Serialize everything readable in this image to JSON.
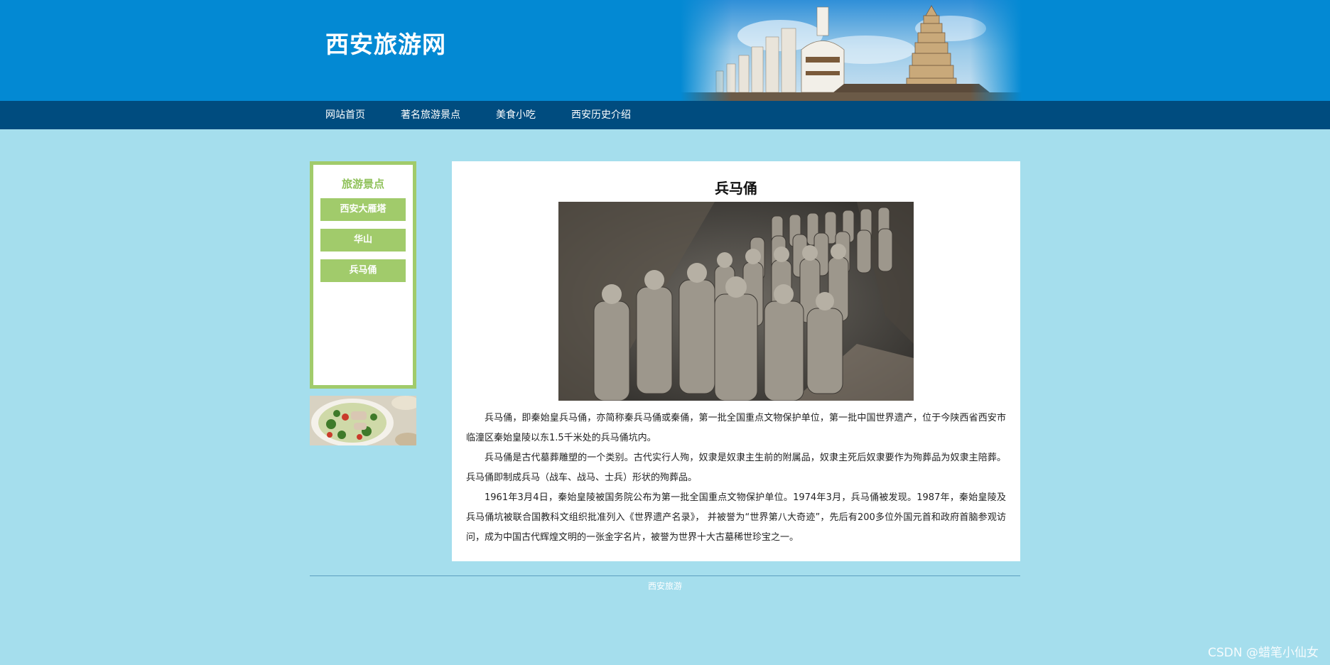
{
  "site": {
    "logo": "西安旅游网"
  },
  "nav": {
    "items": [
      {
        "label": "网站首页"
      },
      {
        "label": "著名旅游景点"
      },
      {
        "label": "美食小吃"
      },
      {
        "label": "西安历史介绍"
      }
    ]
  },
  "sidebar": {
    "title": "旅游景点",
    "items": [
      {
        "label": "西安大雁塔"
      },
      {
        "label": "华山"
      },
      {
        "label": "兵马俑"
      }
    ]
  },
  "article": {
    "title": "兵马俑",
    "paragraphs": [
      "兵马俑，即秦始皇兵马俑，亦简称秦兵马俑或秦俑，第一批全国重点文物保护单位，第一批中国世界遗产，位于今陕西省西安市临潼区秦始皇陵以东1.5千米处的兵马俑坑内。",
      "兵马俑是古代墓葬雕塑的一个类别。古代实行人殉，奴隶是奴隶主生前的附属品，奴隶主死后奴隶要作为殉葬品为奴隶主陪葬。兵马俑即制成兵马（战车、战马、士兵）形状的殉葬品。",
      "1961年3月4日，秦始皇陵被国务院公布为第一批全国重点文物保护单位。1974年3月，兵马俑被发现。1987年，秦始皇陵及兵马俑坑被联合国教科文组织批准列入《世界遗产名录》， 并被誉为“世界第八大奇迹”，先后有200多位外国元首和政府首脑参观访问，成为中国古代辉煌文明的一张金字名片，被誉为世界十大古墓稀世珍宝之一。"
    ]
  },
  "footer": {
    "text": "西安旅游"
  },
  "watermark": "CSDN @蜡笔小仙女",
  "colors": {
    "header_bg": "#0389d3",
    "nav_bg": "#004c7f",
    "page_bg": "#a5deed",
    "sidebar_accent": "#a1cb6b"
  }
}
